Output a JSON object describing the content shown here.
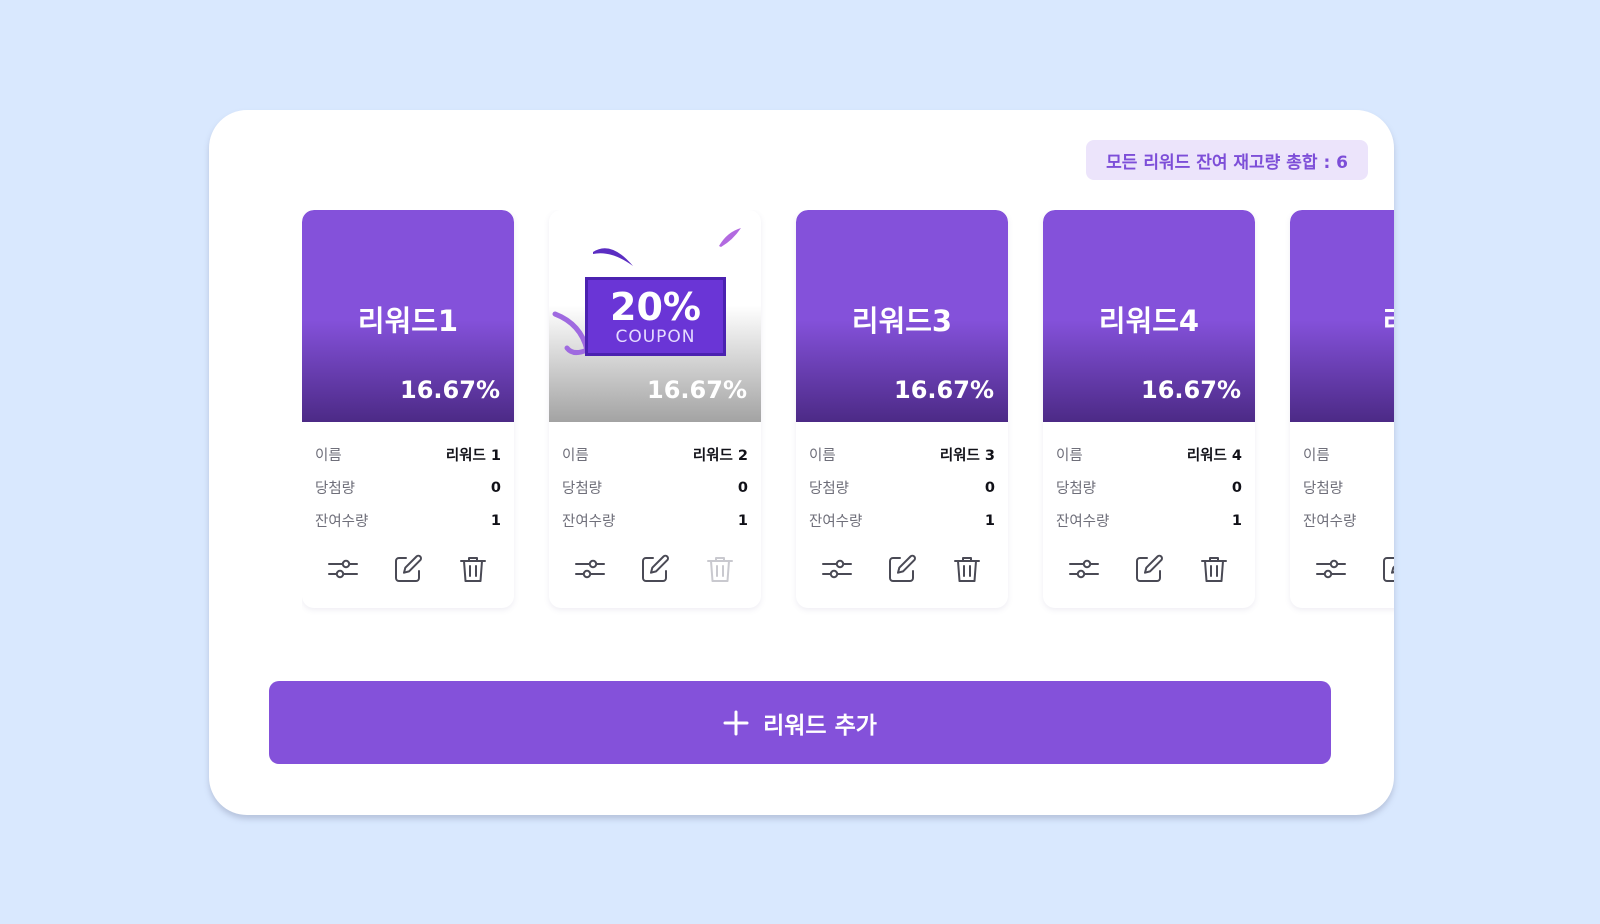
{
  "summary": {
    "total_label": "모든 리워드 잔여 재고량 총합 : 6"
  },
  "labels": {
    "name": "이름",
    "won": "당첨량",
    "remaining": "잔여수량"
  },
  "rewards": [
    {
      "title": "리워드1",
      "percent": "16.67%",
      "name": "리워드 1",
      "won": "0",
      "remaining": "1"
    },
    {
      "title": "",
      "percent": "16.67%",
      "name": "리워드 2",
      "won": "0",
      "remaining": "1",
      "coupon": {
        "big": "20%",
        "small": "COUPON"
      }
    },
    {
      "title": "리워드3",
      "percent": "16.67%",
      "name": "리워드 3",
      "won": "0",
      "remaining": "1"
    },
    {
      "title": "리워드4",
      "percent": "16.67%",
      "name": "리워드 4",
      "won": "0",
      "remaining": "1"
    },
    {
      "title": "리",
      "percent": "",
      "name": "",
      "won": "",
      "remaining": ""
    }
  ],
  "add_button": {
    "label": "리워드 추가"
  },
  "colors": {
    "accent": "#8451da",
    "background": "#d9e8fe",
    "badge_bg": "#ece4fb",
    "icon": "#4a4a55",
    "icon_disabled": "#c9c9cf"
  },
  "icons": [
    "sliders-icon",
    "edit-icon",
    "trash-icon",
    "plus-icon"
  ]
}
